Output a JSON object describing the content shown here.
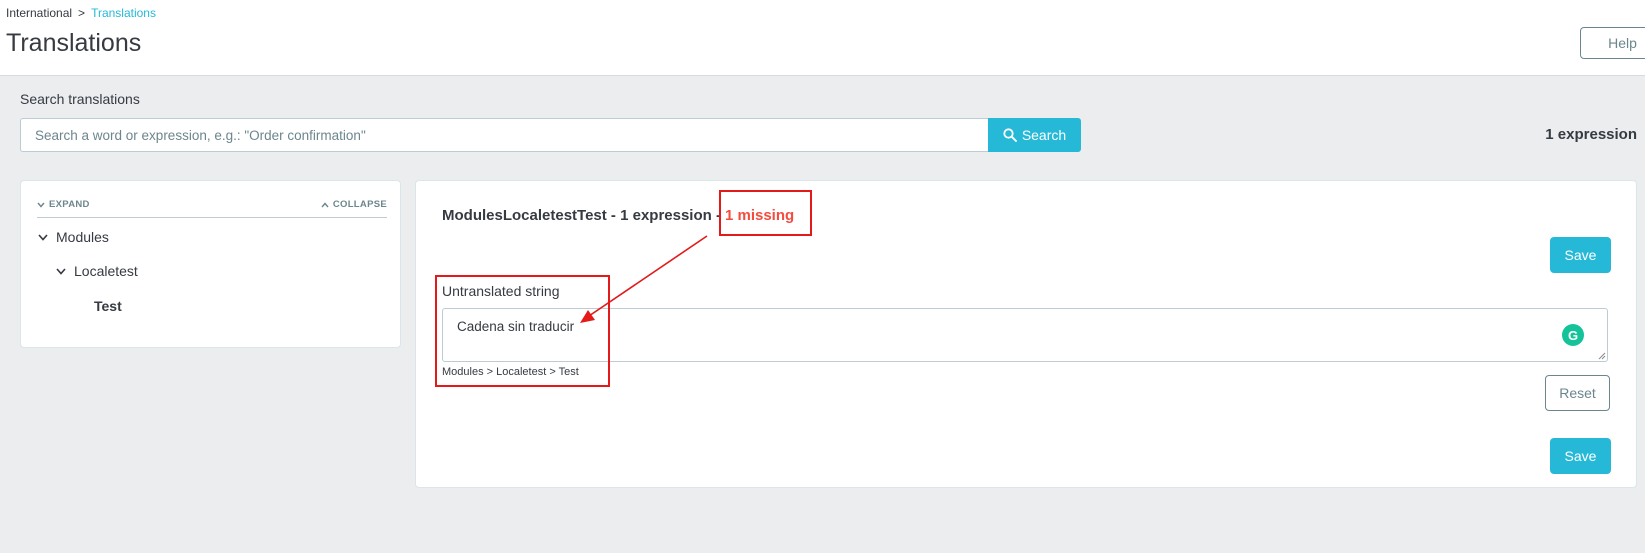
{
  "breadcrumb": {
    "parent": "International",
    "separator": ">",
    "current": "Translations"
  },
  "header": {
    "title": "Translations",
    "help_label": "Help"
  },
  "search": {
    "label": "Search translations",
    "placeholder": "Search a word or expression, e.g.: \"Order confirmation\"",
    "button_label": "Search",
    "result_count": "1 expression"
  },
  "tree": {
    "expand_label": "EXPAND",
    "collapse_label": "COLLAPSE",
    "items": [
      {
        "label": "Modules"
      },
      {
        "label": "Localetest"
      },
      {
        "label": "Test"
      }
    ]
  },
  "content": {
    "domain_title": "ModulesLocaletestTest - 1 expression - ",
    "missing_label": "1 missing",
    "save_label": "Save",
    "reset_label": "Reset",
    "field_label": "Untranslated string",
    "translation_value": "Cadena sin traducir",
    "string_path": "Modules > Localetest > Test",
    "grammarly_letter": "G"
  },
  "colors": {
    "accent": "#25b9d7",
    "missing": "#f54c3e",
    "annotation": "#e3191a",
    "grammarly": "#15c39a"
  },
  "icons": [
    "search-icon",
    "chevron-down-icon",
    "chevron-up-icon",
    "grammarly-icon",
    "resize-grip-icon"
  ]
}
